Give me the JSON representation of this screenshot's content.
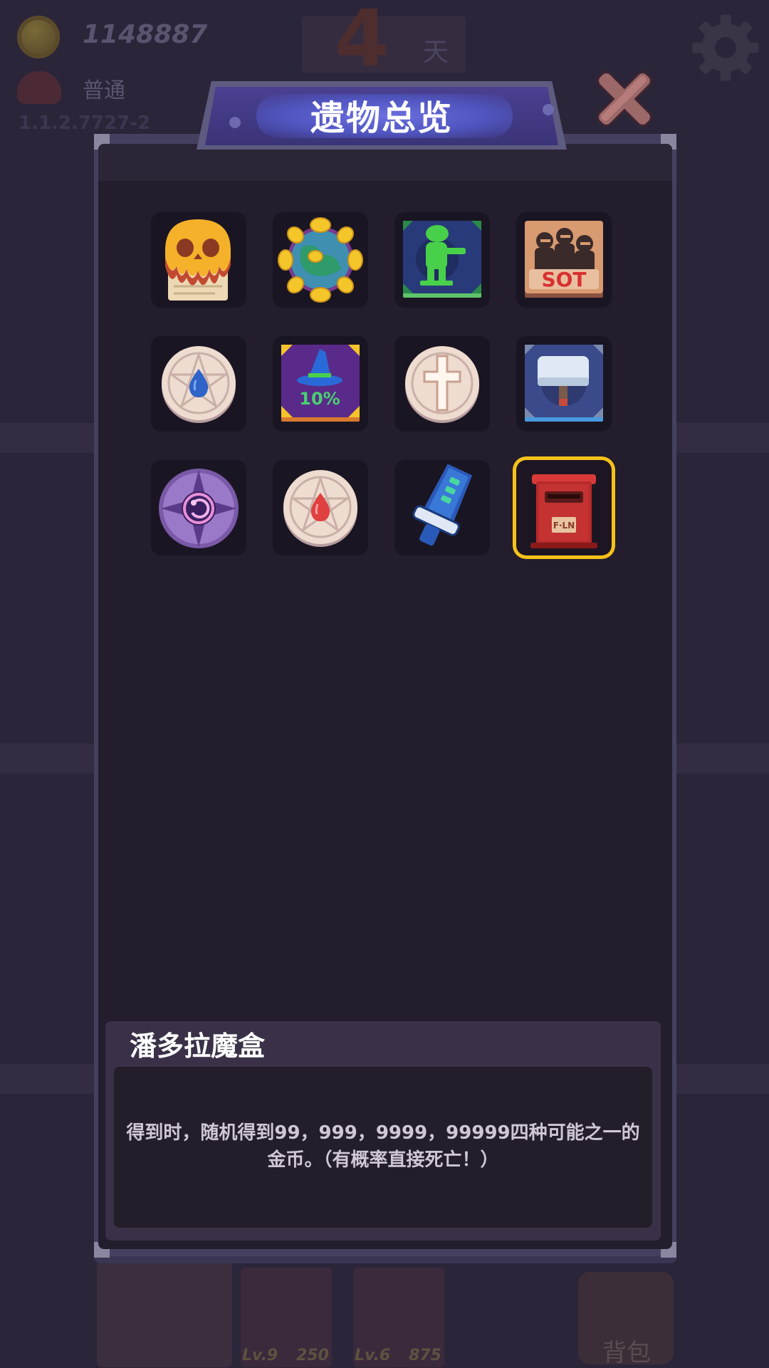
{
  "hud": {
    "coins": "1148887",
    "difficulty": "普通",
    "version": "1.1.2.7727-2",
    "day_number": "4",
    "day_unit": "天"
  },
  "bottom_bar": {
    "slots": [
      {
        "level": "Lv.9",
        "cost": "250"
      },
      {
        "level": "Lv.6",
        "cost": "875"
      }
    ],
    "bag_label": "背包"
  },
  "modal": {
    "title": "遗物总览",
    "relics": [
      {
        "icon": "melting-skull-scroll-icon"
      },
      {
        "icon": "spiky-gem-orb-icon"
      },
      {
        "icon": "green-soldier-book-icon"
      },
      {
        "icon": "sot-gang-book-icon"
      },
      {
        "icon": "blue-drop-pentagram-disc-icon"
      },
      {
        "icon": "wizard-hat-book-icon",
        "label": "10%"
      },
      {
        "icon": "holy-cross-disc-icon"
      },
      {
        "icon": "hammer-book-icon"
      },
      {
        "icon": "purple-eye-compass-icon"
      },
      {
        "icon": "red-drop-pentagram-disc-icon"
      },
      {
        "icon": "blue-sword-hilt-icon"
      },
      {
        "icon": "red-mailbox-icon",
        "selected": true
      }
    ],
    "selected_relic": {
      "name": "潘多拉魔盒",
      "description": "得到时，随机得到99，999，9999，99999四种可能之一的金币。（有概率直接死亡！）"
    }
  },
  "colors": {
    "selection_border": "#f6c21a",
    "panel_bg": "#231d2d",
    "title_glow": "#6c6fe0"
  }
}
